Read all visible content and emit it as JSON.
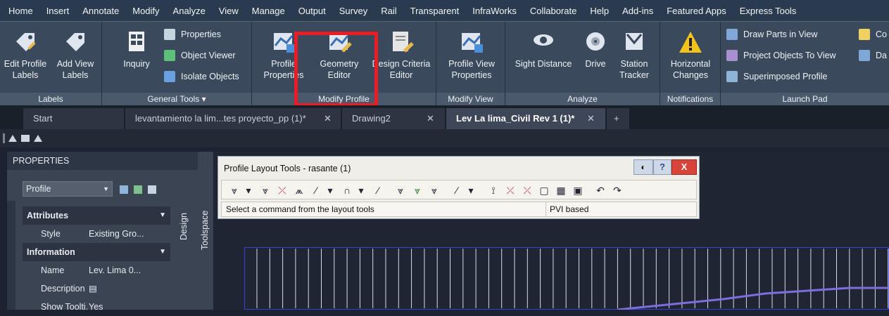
{
  "menu": [
    "Home",
    "Insert",
    "Annotate",
    "Modify",
    "Analyze",
    "View",
    "Manage",
    "Output",
    "Survey",
    "Rail",
    "Transparent",
    "InfraWorks",
    "Collaborate",
    "Help",
    "Add-ins",
    "Featured Apps",
    "Express Tools"
  ],
  "ribbon": {
    "labels": {
      "title": "Labels",
      "edit_profile": "Edit Profile",
      "edit_profile2": "Labels",
      "add_view": "Add View",
      "add_view2": "Labels"
    },
    "general": {
      "title": "General Tools",
      "inquiry": "Inquiry",
      "properties": "Properties",
      "object_viewer": "Object Viewer",
      "isolate": "Isolate Objects"
    },
    "modify_profile": {
      "title": "Modify Profile",
      "profile_properties": "Profile",
      "profile_properties2": "Properties",
      "geometry_editor": "Geometry",
      "geometry_editor2": "Editor",
      "design_criteria": "Design Criteria",
      "design_criteria2": "Editor"
    },
    "modify_view": {
      "title": "Modify View",
      "pv_properties": "Profile View",
      "pv_properties2": "Properties"
    },
    "analyze": {
      "title": "Analyze",
      "sight": "Sight Distance",
      "drive": "Drive",
      "station": "Station",
      "station2": "Tracker"
    },
    "notifications": {
      "title": "Notifications",
      "horizontal": "Horizontal",
      "horizontal2": "Changes"
    },
    "launch": {
      "title": "Launch Pad",
      "draw_parts": "Draw Parts in View",
      "project_objects": "Project Objects To View",
      "superimposed": "Superimposed Profile",
      "co": "Co",
      "da": "Da"
    }
  },
  "tabs": {
    "start": "Start",
    "t1": "levantamiento la lim...tes proyecto_pp (1)*",
    "t2": "Drawing2",
    "t3": "Lev La lima_Civil Rev 1 (1)*",
    "close": "✕",
    "new": "+"
  },
  "properties": {
    "title": "PROPERTIES",
    "object": "Profile",
    "attributes": "Attributes",
    "style_k": "Style",
    "style_v": "Existing Gro...",
    "information": "Information",
    "name_k": "Name",
    "name_v": "Lev. Lima 0...",
    "desc_k": "Description",
    "tooltip_k": "Show Toolti...",
    "tooltip_v": "Yes",
    "design": "Design",
    "toolspace": "Toolspace"
  },
  "plt": {
    "title": "Profile Layout Tools - rasante (1)",
    "status": "Select a command from the layout tools",
    "mode": "PVI based",
    "help": "?",
    "close": "X"
  }
}
